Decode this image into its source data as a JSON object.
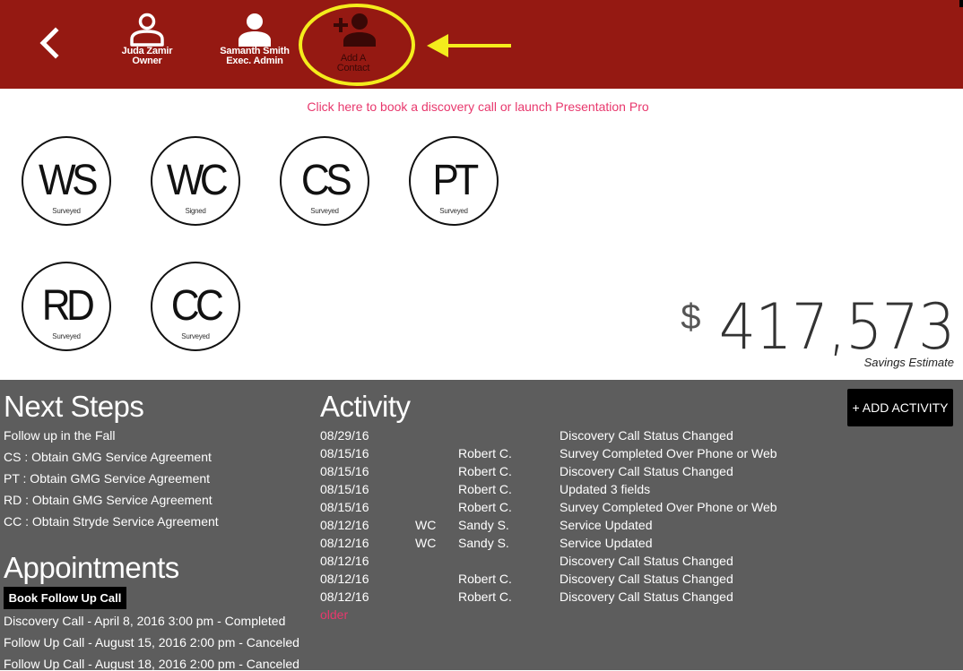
{
  "header": {
    "contacts": [
      {
        "name": "Juda Zamir",
        "role": "Owner"
      },
      {
        "name": "Samanth Smith",
        "role": "Exec. Admin"
      }
    ],
    "add_contact": {
      "line1": "Add A",
      "line2": "Contact"
    },
    "icons": {
      "back": "chevron-left-icon",
      "person_outline": "user-outline-icon",
      "person": "user-icon",
      "add_person": "user-plus-icon"
    }
  },
  "cta_link": "Click here to book a discovery call or launch Presentation Pro",
  "services": [
    {
      "abbr": "WS",
      "status": "Surveyed"
    },
    {
      "abbr": "WC",
      "status": "Signed"
    },
    {
      "abbr": "CS",
      "status": "Surveyed"
    },
    {
      "abbr": "PT",
      "status": "Surveyed"
    },
    {
      "abbr": "RD",
      "status": "Surveyed"
    },
    {
      "abbr": "CC",
      "status": "Surveyed"
    }
  ],
  "savings": {
    "currency": "$",
    "amount": "417,573",
    "label": "Savings Estimate"
  },
  "next_steps": {
    "title": "Next Steps",
    "items": [
      "Follow up in the Fall",
      "CS : Obtain GMG Service Agreement",
      "PT : Obtain GMG Service Agreement",
      "RD : Obtain GMG Service Agreement",
      "CC : Obtain Stryde Service Agreement"
    ]
  },
  "appointments": {
    "title": "Appointments",
    "book_button": "Book Follow Up Call",
    "items": [
      "Discovery Call - April 8, 2016 3:00 pm - Completed",
      "Follow Up Call - August 15, 2016 2:00 pm - Canceled",
      "Follow Up Call - August 18, 2016 2:00 pm - Canceled"
    ]
  },
  "activity": {
    "title": "Activity",
    "add_button": "+ ADD ACTIVITY",
    "older_link": "older",
    "rows": [
      {
        "date": "08/29/16",
        "svc": "",
        "user": "",
        "desc": "Discovery Call Status Changed"
      },
      {
        "date": "08/15/16",
        "svc": "",
        "user": "Robert C.",
        "desc": "Survey Completed Over Phone or Web"
      },
      {
        "date": "08/15/16",
        "svc": "",
        "user": "Robert C.",
        "desc": "Discovery Call Status Changed"
      },
      {
        "date": "08/15/16",
        "svc": "",
        "user": "Robert C.",
        "desc": "Updated 3 fields"
      },
      {
        "date": "08/15/16",
        "svc": "",
        "user": "Robert C.",
        "desc": "Survey Completed Over Phone or Web"
      },
      {
        "date": "08/12/16",
        "svc": "WC",
        "user": "Sandy S.",
        "desc": "Service Updated"
      },
      {
        "date": "08/12/16",
        "svc": "WC",
        "user": "Sandy S.",
        "desc": "Service Updated"
      },
      {
        "date": "08/12/16",
        "svc": "",
        "user": "",
        "desc": "Discovery Call Status Changed"
      },
      {
        "date": "08/12/16",
        "svc": "",
        "user": "Robert C.",
        "desc": "Discovery Call Status Changed"
      },
      {
        "date": "08/12/16",
        "svc": "",
        "user": "Robert C.",
        "desc": "Discovery Call Status Changed"
      }
    ]
  },
  "colors": {
    "header": "#951912",
    "panel": "#5d5d5d",
    "link": "#e8386d",
    "annotation": "#f4ec1c"
  }
}
